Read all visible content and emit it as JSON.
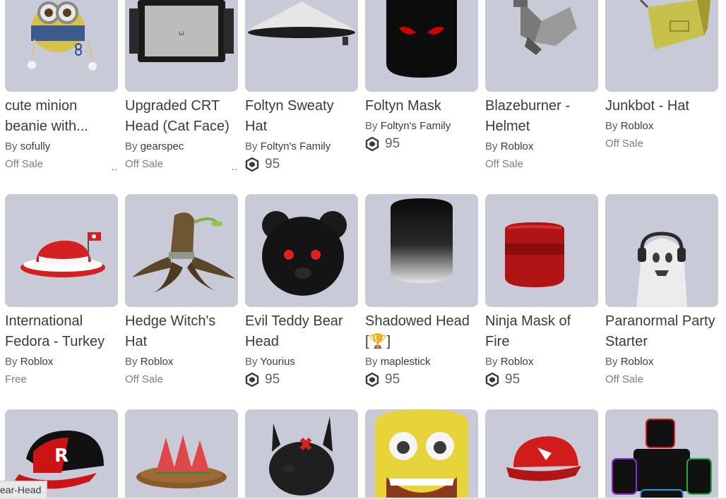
{
  "rows": [
    [
      {
        "name": "cute minion beanie with...",
        "by": "By",
        "creator": "sofully",
        "price": "Off Sale",
        "price_type": "text",
        "more": ".."
      },
      {
        "name": "Upgraded CRT Head (Cat Face)",
        "by": "By",
        "creator": "gearspec",
        "price": "Off Sale",
        "price_type": "text",
        "more": ".."
      },
      {
        "name": "Foltyn Sweaty Hat",
        "by": "By",
        "creator": "Foltyn's Family",
        "price": "95",
        "price_type": "robux"
      },
      {
        "name": "Foltyn Mask",
        "by": "By",
        "creator": "Foltyn's Family",
        "price": "95",
        "price_type": "robux"
      },
      {
        "name": "Blazeburner - Helmet",
        "by": "By",
        "creator": "Roblox",
        "price": "Off Sale",
        "price_type": "text"
      },
      {
        "name": "Junkbot - Hat",
        "by": "By",
        "creator": "Roblox",
        "price": "Off Sale",
        "price_type": "text"
      }
    ],
    [
      {
        "name": "International Fedora - Turkey",
        "by": "By",
        "creator": "Roblox",
        "price": "Free",
        "price_type": "text"
      },
      {
        "name": "Hedge Witch's Hat",
        "by": "By",
        "creator": "Roblox",
        "price": "Off Sale",
        "price_type": "text"
      },
      {
        "name": "Evil Teddy Bear Head",
        "by": "By",
        "creator": "Yourius",
        "price": "95",
        "price_type": "robux"
      },
      {
        "name": "Shadowed Head [🏆]",
        "by": "By",
        "creator": "maplestick",
        "price": "95",
        "price_type": "robux"
      },
      {
        "name": "Ninja Mask of Fire",
        "by": "By",
        "creator": "Roblox",
        "price": "95",
        "price_type": "robux"
      },
      {
        "name": "Paranormal Party Starter",
        "by": "By",
        "creator": "Roblox",
        "price": "Off Sale",
        "price_type": "text"
      }
    ],
    [
      {
        "name": "",
        "by": "",
        "creator": "",
        "price": "",
        "price_type": "none"
      },
      {
        "name": "",
        "by": "",
        "creator": "",
        "price": "",
        "price_type": "none"
      },
      {
        "name": "",
        "by": "",
        "creator": "",
        "price": "",
        "price_type": "none"
      },
      {
        "name": "",
        "by": "",
        "creator": "",
        "price": "",
        "price_type": "none"
      },
      {
        "name": "",
        "by": "",
        "creator": "",
        "price": "",
        "price_type": "none"
      },
      {
        "name": "",
        "by": "",
        "creator": "",
        "price": "",
        "price_type": "none"
      }
    ]
  ],
  "tooltip": {
    "text": "ear-Head"
  },
  "colors": {
    "thumb_bg": "#c8cad7",
    "text_primary": "#393b3d",
    "text_secondary": "#606162",
    "robux_icon": "#393b3d"
  },
  "icons": {
    "robux": "robux-icon",
    "more": "more-dots-icon"
  }
}
